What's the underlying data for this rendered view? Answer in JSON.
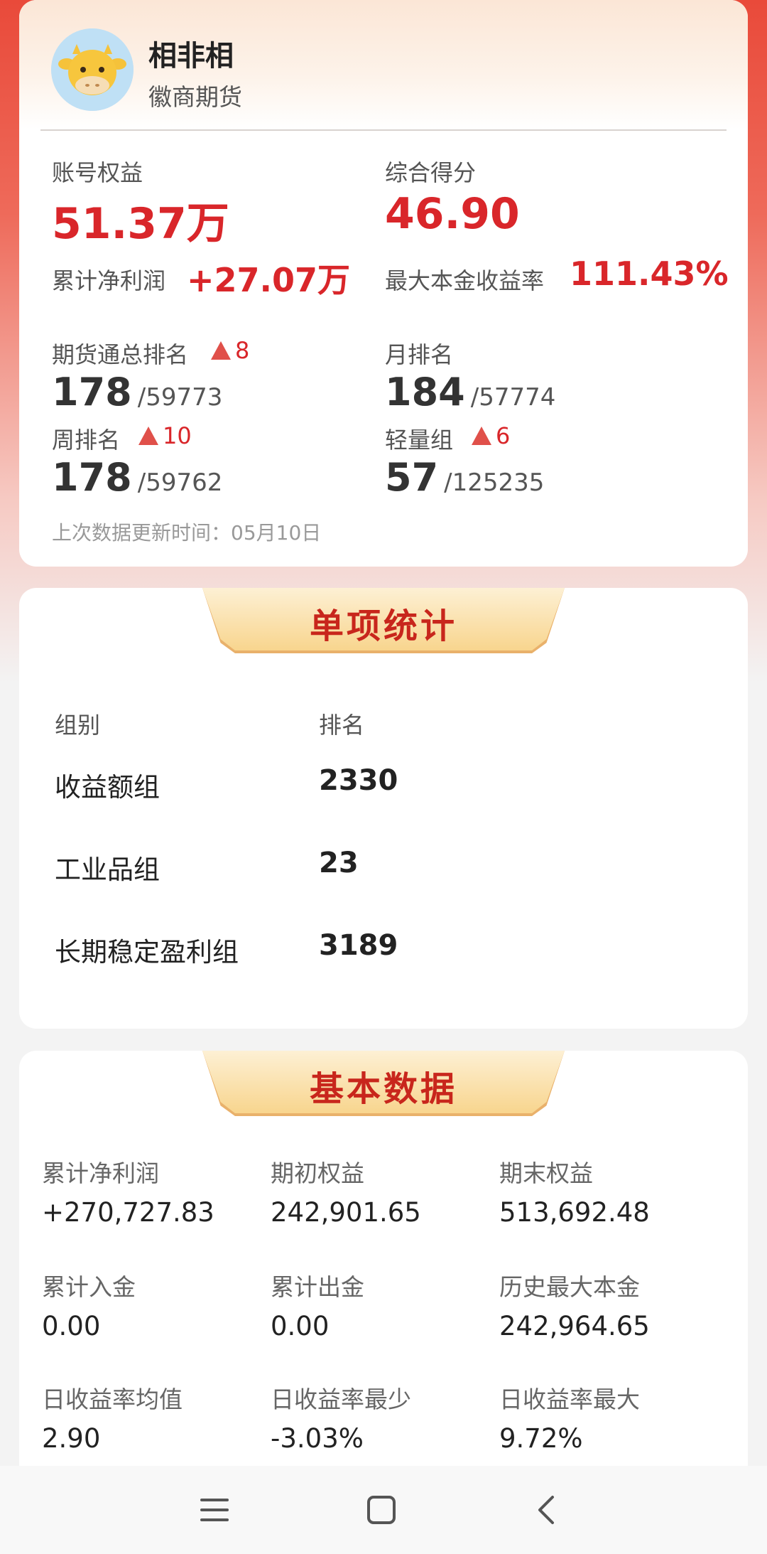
{
  "profile": {
    "name": "相非相",
    "company": "徽商期货"
  },
  "summary": {
    "equity_label": "账号权益",
    "equity_value": "51.37万",
    "score_label": "综合得分",
    "score_value": "46.90",
    "net_profit_label": "累计净利润",
    "net_profit_value": "+27.07万",
    "max_return_label": "最大本金收益率",
    "max_return_value": "111.43%"
  },
  "rankings": [
    {
      "label": "期货通总排名",
      "change": "8",
      "rank": "178",
      "total": "/59773"
    },
    {
      "label": "月排名",
      "change": "",
      "rank": "184",
      "total": "/57774"
    },
    {
      "label": "周排名",
      "change": "10",
      "rank": "178",
      "total": "/59762"
    },
    {
      "label": "轻量组",
      "change": "6",
      "rank": "57",
      "total": "/125235"
    }
  ],
  "update_text": "上次数据更新时间：05月10日",
  "stats": {
    "title": "单项统计",
    "col_group": "组别",
    "col_rank": "排名",
    "rows": [
      {
        "group": "收益额组",
        "rank": "2330"
      },
      {
        "group": "工业品组",
        "rank": "23"
      },
      {
        "group": "长期稳定盈利组",
        "rank": "3189"
      }
    ]
  },
  "basic": {
    "title": "基本数据",
    "items": [
      {
        "label": "累计净利润",
        "value": "+270,727.83"
      },
      {
        "label": "期初权益",
        "value": "242,901.65"
      },
      {
        "label": "期末权益",
        "value": "513,692.48"
      },
      {
        "label": "累计入金",
        "value": "0.00"
      },
      {
        "label": "累计出金",
        "value": "0.00"
      },
      {
        "label": "历史最大本金",
        "value": "242,964.65"
      },
      {
        "label": "日收益率均值",
        "value": "2.90"
      },
      {
        "label": "日收益率最少",
        "value": "-3.03%"
      },
      {
        "label": "日收益率最大",
        "value": "9.72%"
      }
    ]
  },
  "icons": {
    "avatar": "cow-avatar-icon",
    "rank_up": "triangle-up-icon",
    "nav_menu": "menu-icon",
    "nav_home": "square-home-icon",
    "nav_back": "chevron-left-icon"
  }
}
